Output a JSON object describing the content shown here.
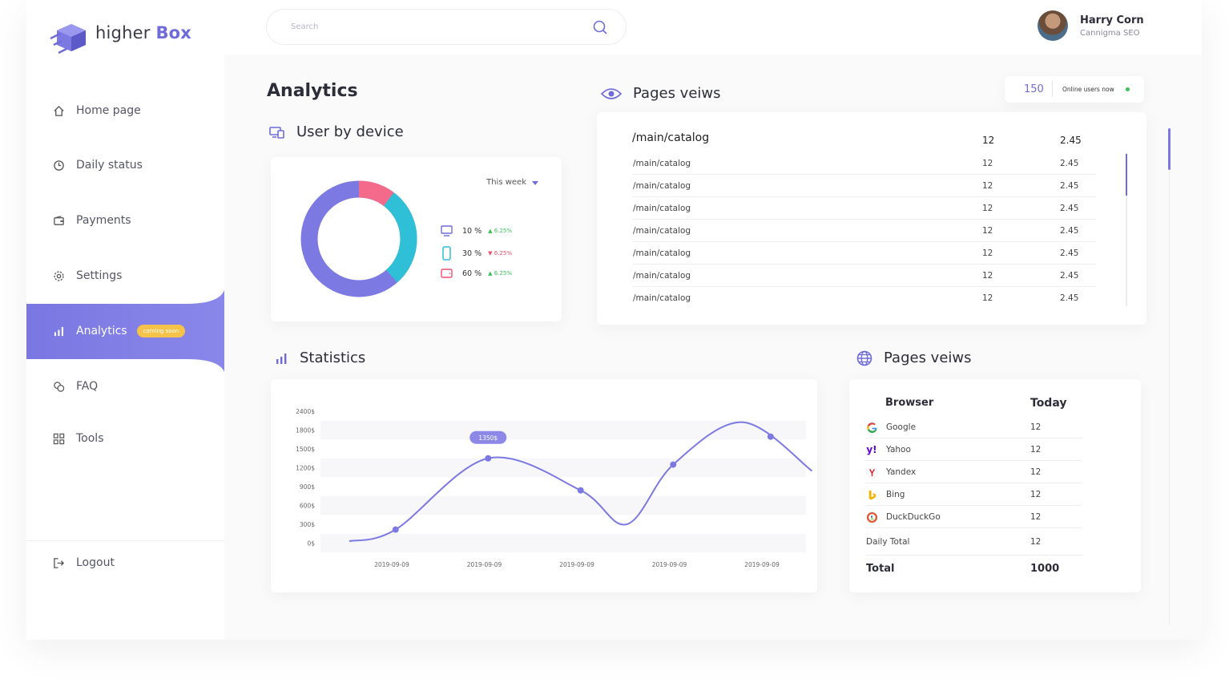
{
  "brand": {
    "name_light": "higher",
    "name_bold": "Box",
    "color": "#6f6cd9"
  },
  "sidebar": {
    "items": [
      {
        "label": "Home page",
        "icon": "home-icon"
      },
      {
        "label": "Daily status",
        "icon": "clock-icon"
      },
      {
        "label": "Payments",
        "icon": "wallet-icon"
      },
      {
        "label": "Settings",
        "icon": "gear-icon"
      },
      {
        "label": "Analytics",
        "icon": "bar-chart-icon",
        "active": true,
        "badge": "coming soon"
      },
      {
        "label": "FAQ",
        "icon": "chat-icon"
      },
      {
        "label": "Tools",
        "icon": "grid-icon"
      }
    ],
    "logout": "Logout"
  },
  "header": {
    "search_placeholder": "Search",
    "user": {
      "name": "Harry Corn",
      "role": "Cannigma SEO"
    }
  },
  "page": {
    "title": "Analytics"
  },
  "device": {
    "title": "User by device",
    "period": "This week",
    "legend": [
      {
        "icon": "desktop-icon",
        "pct": "10 %",
        "change": "6.25%",
        "dir": "up",
        "color": "#6f6cd9"
      },
      {
        "icon": "phone-icon",
        "pct": "30 %",
        "change": "6.25%",
        "dir": "down",
        "color": "#2fbfd6"
      },
      {
        "icon": "tablet-icon",
        "pct": "60 %",
        "change": "6.25%",
        "dir": "up",
        "color": "#f0506e"
      }
    ],
    "donut": {
      "colors": [
        "#f46a8a",
        "#2fbfd6",
        "#7c79e3"
      ]
    }
  },
  "pageviews": {
    "title": "Pages veiws",
    "online_count": "150",
    "online_label": "Online users now",
    "header": {
      "path": "/main/catalog",
      "a": "12",
      "b": "2.45"
    },
    "rows": [
      {
        "path": "/main/catalog",
        "a": "12",
        "b": "2.45"
      },
      {
        "path": "/main/catalog",
        "a": "12",
        "b": "2.45"
      },
      {
        "path": "/main/catalog",
        "a": "12",
        "b": "2.45"
      },
      {
        "path": "/main/catalog",
        "a": "12",
        "b": "2.45"
      },
      {
        "path": "/main/catalog",
        "a": "12",
        "b": "2.45"
      },
      {
        "path": "/main/catalog",
        "a": "12",
        "b": "2.45"
      },
      {
        "path": "/main/catalog",
        "a": "12",
        "b": "2.45"
      }
    ]
  },
  "statistics": {
    "title": "Statistics",
    "tooltip": "1350$",
    "chart_data": {
      "type": "line",
      "y_ticks": [
        "2400$",
        "1800$",
        "1500$",
        "1200$",
        "900$",
        "600$",
        "300$",
        "0$"
      ],
      "x_ticks": [
        "2019-09-09",
        "2019-09-09",
        "2019-09-09",
        "2019-09-09",
        "2019-09-09"
      ],
      "grid": "horizontal bands",
      "series": [
        {
          "color": "#7c79e3",
          "points": [
            [
              0.0,
              30
            ],
            [
              0.5,
              215
            ],
            [
              1.5,
              1350
            ],
            [
              2.5,
              840
            ],
            [
              3.0,
              300
            ],
            [
              3.5,
              1250
            ],
            [
              4.25,
              2050
            ],
            [
              5.0,
              1150
            ]
          ]
        }
      ]
    }
  },
  "browsers": {
    "title": "Pages veiws",
    "col_browser": "Browser",
    "col_today": "Today",
    "rows": [
      {
        "name": "Google",
        "value": "12",
        "icon": "google-icon"
      },
      {
        "name": "Yahoo",
        "value": "12",
        "icon": "yahoo-icon"
      },
      {
        "name": "Yandex",
        "value": "12",
        "icon": "yandex-icon"
      },
      {
        "name": "Bing",
        "value": "12",
        "icon": "bing-icon"
      },
      {
        "name": "DuckDuckGo",
        "value": "12",
        "icon": "duckduckgo-icon"
      }
    ],
    "daily_total_label": "Daily Total",
    "daily_total_value": "12",
    "total_label": "Total",
    "total_value": "1000"
  }
}
